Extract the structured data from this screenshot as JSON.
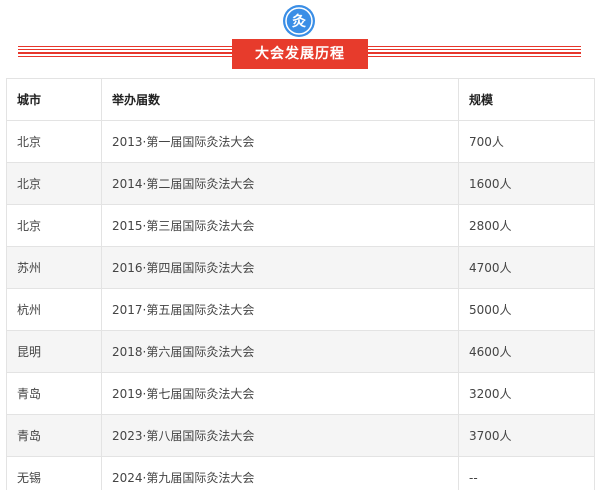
{
  "header": {
    "logo_glyph": "灸",
    "banner_title": "大会发展历程"
  },
  "colors": {
    "accent_red": "#e73b2c",
    "logo_blue": "#3a8ee6"
  },
  "table": {
    "columns": [
      "城市",
      "举办届数",
      "规模"
    ],
    "rows": [
      {
        "city": "北京",
        "edition": "2013·第一届国际灸法大会",
        "scale": "700人"
      },
      {
        "city": "北京",
        "edition": "2014·第二届国际灸法大会",
        "scale": "1600人"
      },
      {
        "city": "北京",
        "edition": "2015·第三届国际灸法大会",
        "scale": "2800人"
      },
      {
        "city": "苏州",
        "edition": "2016·第四届国际灸法大会",
        "scale": "4700人"
      },
      {
        "city": "杭州",
        "edition": "2017·第五届国际灸法大会",
        "scale": "5000人"
      },
      {
        "city": "昆明",
        "edition": "2018·第六届国际灸法大会",
        "scale": "4600人"
      },
      {
        "city": "青岛",
        "edition": "2019·第七届国际灸法大会",
        "scale": "3200人"
      },
      {
        "city": "青岛",
        "edition": "2023·第八届国际灸法大会",
        "scale": "3700人"
      },
      {
        "city": "无锡",
        "edition": "2024·第九届国际灸法大会",
        "scale": "--"
      }
    ]
  }
}
